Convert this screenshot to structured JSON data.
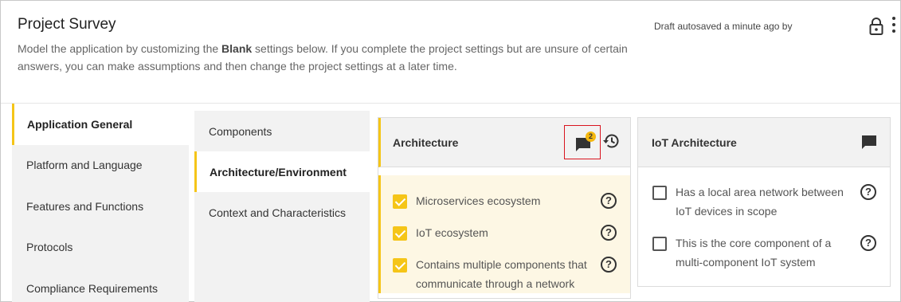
{
  "header": {
    "title": "Project Survey",
    "description_pre": "Model the application by customizing the ",
    "description_bold": "Blank",
    "description_post": " settings below. If you complete the project settings but are unsure of certain answers, you can make assumptions and then change the project settings at a later time.",
    "autosave": "Draft autosaved a minute ago by"
  },
  "nav_primary": [
    {
      "label": "Application General",
      "active": true
    },
    {
      "label": "Platform and Language",
      "active": false
    },
    {
      "label": "Features and Functions",
      "active": false
    },
    {
      "label": "Protocols",
      "active": false
    },
    {
      "label": "Compliance Requirements",
      "active": false
    }
  ],
  "nav_secondary": [
    {
      "label": "Components",
      "active": false
    },
    {
      "label": "Architecture/Environment",
      "active": true
    },
    {
      "label": "Context and Characteristics",
      "active": false
    }
  ],
  "cards": {
    "architecture": {
      "title": "Architecture",
      "comment_count": "2",
      "items": [
        {
          "label": "Microservices ecosystem",
          "checked": true
        },
        {
          "label": "IoT ecosystem",
          "checked": true
        },
        {
          "label": "Contains multiple components that communicate through a network",
          "checked": true
        }
      ]
    },
    "iot_architecture": {
      "title": "IoT Architecture",
      "items": [
        {
          "label": "Has a local area network between IoT devices in scope",
          "checked": false
        },
        {
          "label": "This is the core component of a multi-component IoT system",
          "checked": false
        }
      ]
    }
  },
  "icons": {
    "lock": "lock-icon",
    "more": "kebab-menu-icon",
    "comment": "comment-icon",
    "history": "history-icon",
    "help": "help-icon",
    "help_glyph": "?"
  },
  "colors": {
    "accent": "#f5c518",
    "highlight_bg": "#fdf7e4",
    "badge": "#f5b80f",
    "callout_border": "#d9141f",
    "panel_bg": "#f2f2f2"
  }
}
